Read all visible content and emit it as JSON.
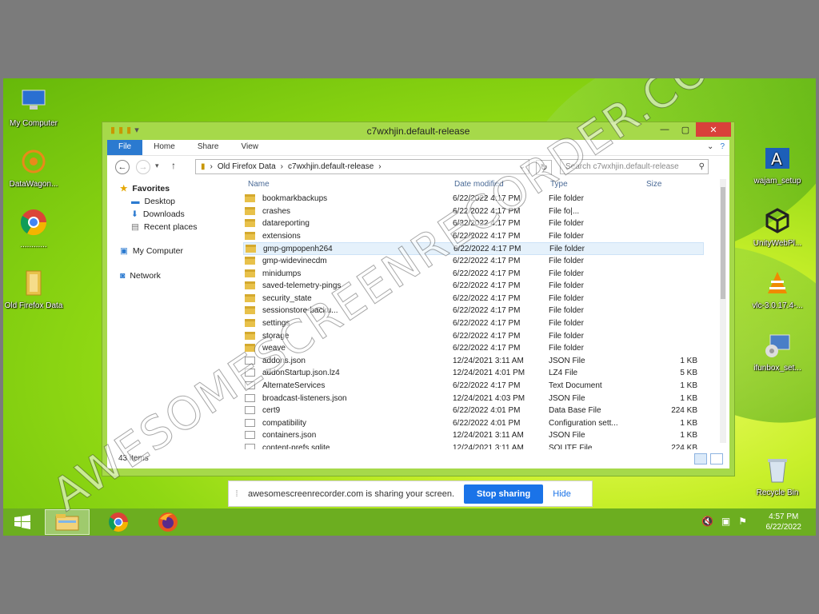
{
  "desktop": {
    "left_icons": [
      {
        "label": "My Computer",
        "icon": "computer-icon"
      },
      {
        "label": "DataWagon...",
        "icon": "datawagon-icon"
      },
      {
        "label": "............",
        "icon": "chrome-icon"
      },
      {
        "label": "Old Firefox Data",
        "icon": "folder-icon"
      }
    ],
    "right_icons": [
      {
        "label": "wajam_setup",
        "icon": "installer-icon"
      },
      {
        "label": "UnityWebPl...",
        "icon": "unity-icon"
      },
      {
        "label": "vlc-3.0.17.4-...",
        "icon": "vlc-icon"
      },
      {
        "label": "ifunbox_set...",
        "icon": "ifunbox-icon"
      },
      {
        "label": "Recycle Bin",
        "icon": "recycle-bin-icon"
      }
    ]
  },
  "window": {
    "title": "c7wxhjin.default-release",
    "ribbon_tabs": [
      "File",
      "Home",
      "Share",
      "View"
    ],
    "address": [
      "Old Firefox Data",
      "c7wxhjin.default-release"
    ],
    "search_placeholder": "Search c7wxhjin.default-release",
    "nav": {
      "favorites": "Favorites",
      "desktop": "Desktop",
      "downloads": "Downloads",
      "recent": "Recent places",
      "computer": "My Computer",
      "network": "Network"
    },
    "columns": {
      "name": "Name",
      "date": "Date modified",
      "type": "Type",
      "size": "Size"
    },
    "files": [
      {
        "name": "bookmarkbackups",
        "date": "6/22/2022 4:17 PM",
        "type": "File folder",
        "size": "",
        "kind": "folder"
      },
      {
        "name": "crashes",
        "date": "6/22/2022 4:17 PM",
        "type": "File fo|...",
        "size": "",
        "kind": "folder"
      },
      {
        "name": "datareporting",
        "date": "6/22/2022 4:17 PM",
        "type": "File folder",
        "size": "",
        "kind": "folder"
      },
      {
        "name": "extensions",
        "date": "6/22/2022 4:17 PM",
        "type": "File folder",
        "size": "",
        "kind": "folder"
      },
      {
        "name": "gmp-gmpopenh264",
        "date": "6/22/2022 4:17 PM",
        "type": "File folder",
        "size": "",
        "kind": "folder"
      },
      {
        "name": "gmp-widevinecdm",
        "date": "6/22/2022 4:17 PM",
        "type": "File folder",
        "size": "",
        "kind": "folder"
      },
      {
        "name": "minidumps",
        "date": "6/22/2022 4:17 PM",
        "type": "File folder",
        "size": "",
        "kind": "folder"
      },
      {
        "name": "saved-telemetry-pings",
        "date": "6/22/2022 4:17 PM",
        "type": "File folder",
        "size": "",
        "kind": "folder"
      },
      {
        "name": "security_state",
        "date": "6/22/2022 4:17 PM",
        "type": "File folder",
        "size": "",
        "kind": "folder"
      },
      {
        "name": "sessionstore-backu...",
        "date": "6/22/2022 4:17 PM",
        "type": "File folder",
        "size": "",
        "kind": "folder"
      },
      {
        "name": "settings",
        "date": "6/22/2022 4:17 PM",
        "type": "File folder",
        "size": "",
        "kind": "folder"
      },
      {
        "name": "storage",
        "date": "6/22/2022 4:17 PM",
        "type": "File folder",
        "size": "",
        "kind": "folder"
      },
      {
        "name": "weave",
        "date": "6/22/2022 4:17 PM",
        "type": "File folder",
        "size": "",
        "kind": "folder"
      },
      {
        "name": "addons.json",
        "date": "12/24/2021 3:11 AM",
        "type": "JSON File",
        "size": "1 KB",
        "kind": "file"
      },
      {
        "name": "addonStartup.json.lz4",
        "date": "12/24/2021 4:01 PM",
        "type": "LZ4 File",
        "size": "5 KB",
        "kind": "file"
      },
      {
        "name": "AlternateServices",
        "date": "6/22/2022 4:17 PM",
        "type": "Text Document",
        "size": "1 KB",
        "kind": "file"
      },
      {
        "name": "broadcast-listeners.json",
        "date": "12/24/2021 4:03 PM",
        "type": "JSON File",
        "size": "1 KB",
        "kind": "file"
      },
      {
        "name": "cert9",
        "date": "6/22/2022 4:01 PM",
        "type": "Data Base File",
        "size": "224 KB",
        "kind": "file"
      },
      {
        "name": "compatibility",
        "date": "6/22/2022 4:01 PM",
        "type": "Configuration sett...",
        "size": "1 KB",
        "kind": "file"
      },
      {
        "name": "containers.json",
        "date": "12/24/2021 3:11 AM",
        "type": "JSON File",
        "size": "1 KB",
        "kind": "file"
      },
      {
        "name": "content-prefs.sqlite",
        "date": "12/24/2021 3:11 AM",
        "type": "SQLITE File",
        "size": "224 KB",
        "kind": "file"
      }
    ],
    "selected_index": 4,
    "item_count": "43 items"
  },
  "share_bar": {
    "message": "awesomescreenrecorder.com is sharing your screen.",
    "stop": "Stop sharing",
    "hide": "Hide"
  },
  "taskbar": {
    "time": "4:57 PM",
    "date": "6/22/2022"
  },
  "watermark": "AWESOMESCREENRECORDER.COM",
  "colors": {
    "accent": "#2b7ad0",
    "share_button": "#1a73e8",
    "close": "#d9413a"
  }
}
